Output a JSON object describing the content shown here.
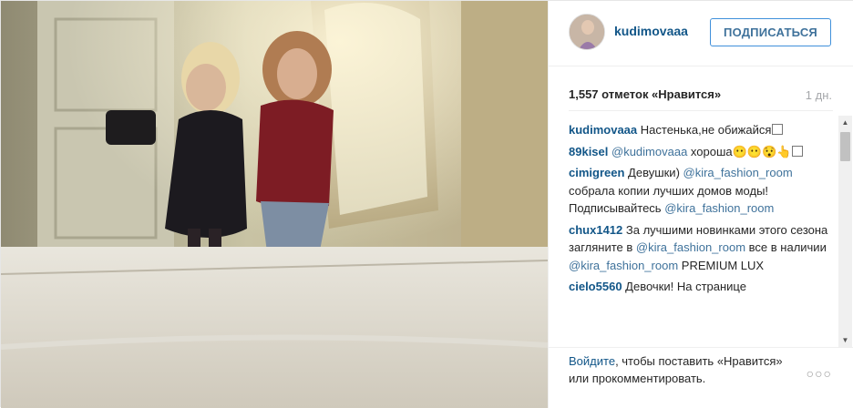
{
  "post": {
    "username": "kudimovaaa",
    "follow_label": "ПОДПИСАТЬСЯ",
    "likes_text": "1,557 отметок «Нравится»",
    "time_ago": "1 дн."
  },
  "comments": [
    {
      "user": "kudimovaaa",
      "parts": [
        {
          "t": "text",
          "v": " Настенька,не обижайся"
        }
      ],
      "emoji_box": true
    },
    {
      "user": "89kisel",
      "parts": [
        {
          "t": "text",
          "v": " "
        },
        {
          "t": "mention",
          "v": "@kudimovaaa"
        },
        {
          "t": "text",
          "v": " хороша😶😶😯👆"
        }
      ],
      "emoji_box": true
    },
    {
      "user": "cimigreen",
      "parts": [
        {
          "t": "text",
          "v": " Девушки) "
        },
        {
          "t": "mention",
          "v": "@kira_fashion_room"
        },
        {
          "t": "text",
          "v": " собрала копии лучших домов моды! Подписывайтесь "
        },
        {
          "t": "mention",
          "v": "@kira_fashion_room"
        }
      ]
    },
    {
      "user": "chux1412",
      "parts": [
        {
          "t": "text",
          "v": " За лучшими новинками этого сезона загляните в "
        },
        {
          "t": "mention",
          "v": "@kira_fashion_room"
        },
        {
          "t": "text",
          "v": " все в наличии "
        },
        {
          "t": "mention",
          "v": "@kira_fashion_room"
        },
        {
          "t": "text",
          "v": " PREMIUM LUX"
        }
      ]
    },
    {
      "user": "cielo5560",
      "parts": [
        {
          "t": "text",
          "v": " Девочки! На странице"
        }
      ]
    }
  ],
  "footer": {
    "login_link": "Войдите",
    "login_rest": ", чтобы поставить «Нравится» или прокомментировать.",
    "more_glyph": "○○○"
  },
  "scrollbar": {
    "up": "▲",
    "down": "▼"
  },
  "icons": {
    "more": "more-options-icon"
  }
}
